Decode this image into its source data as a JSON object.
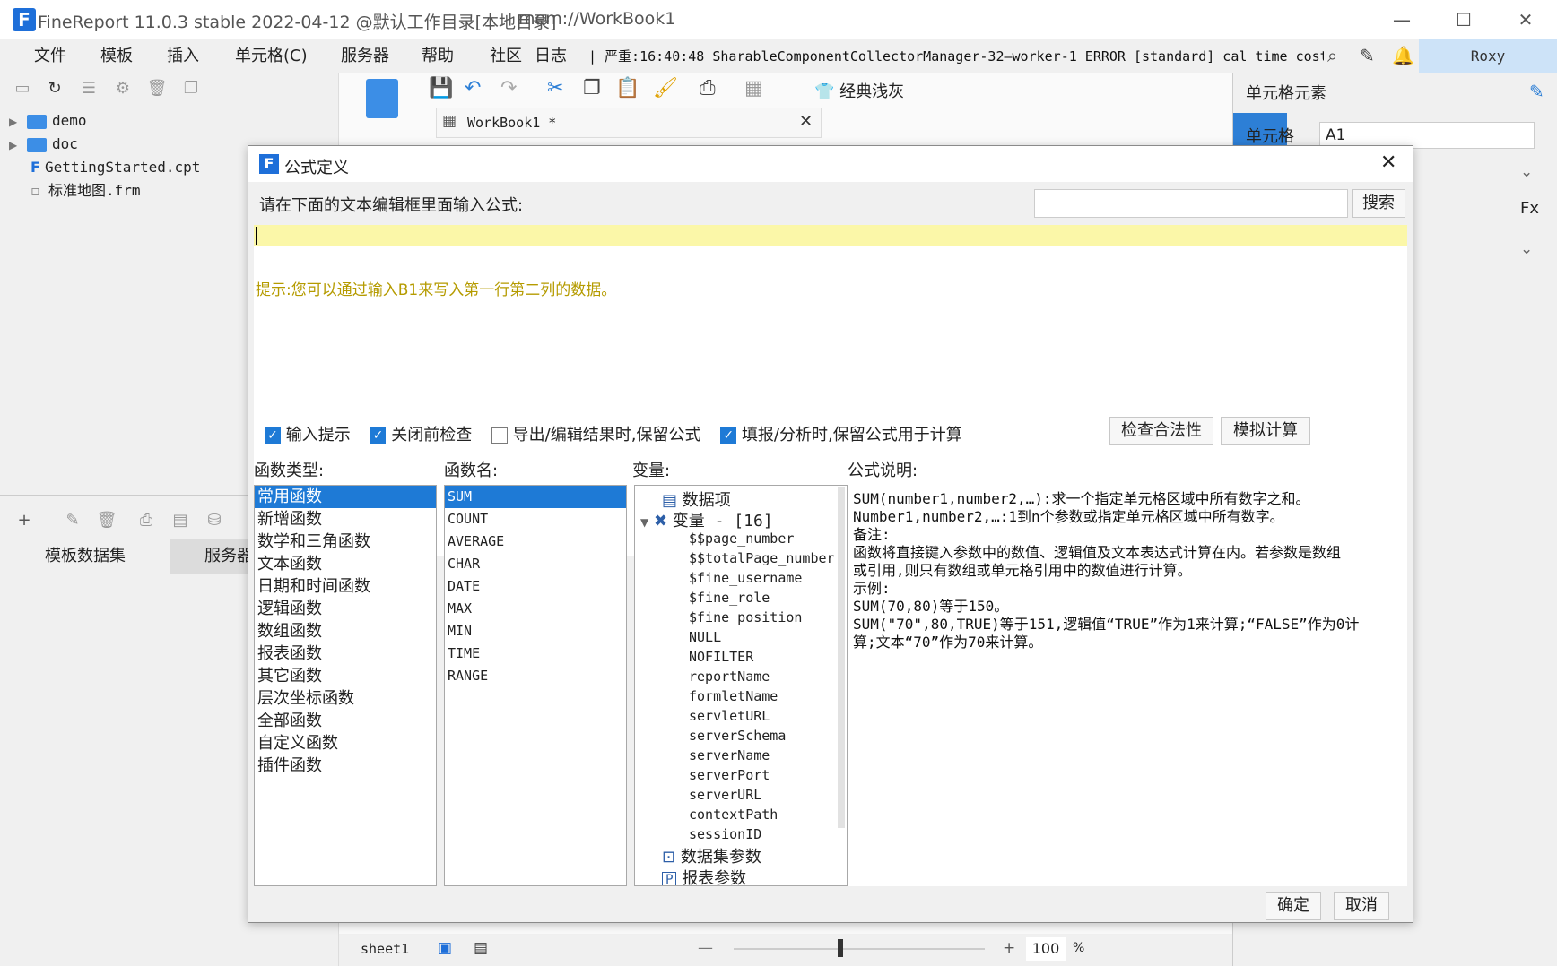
{
  "app": {
    "title": "FineReport 11.0.3 stable 2022-04-12 @默认工作目录[本地目录]",
    "path": "mem://WorkBook1",
    "user": "Roxy"
  },
  "window_controls": {
    "minimize": "—",
    "maximize": "☐",
    "close": "✕"
  },
  "menu": [
    "文件",
    "模板",
    "插入",
    "单元格(C)",
    "服务器",
    "帮助",
    "社区",
    "日志"
  ],
  "log_line": "| 严重:16:40:48 SharableComponentCollectorManager-32—worker-1 ERROR [standard] cal time cost...",
  "left": {
    "tree": [
      {
        "label": "demo",
        "type": "folder"
      },
      {
        "label": "doc",
        "type": "folder"
      },
      {
        "label": "GettingStarted.cpt",
        "type": "file"
      },
      {
        "label": "标准地图.frm",
        "type": "file"
      }
    ],
    "bottom_tabs": [
      "模板数据集",
      "服务器"
    ]
  },
  "center": {
    "tab_label": "WorkBook1 *",
    "theme_button": "经典浅灰",
    "sheet": "sheet1",
    "zoom": "100",
    "zoom_unit": "%"
  },
  "right": {
    "title": "单元格元素",
    "cell_label": "单元格",
    "cell_value": "A1"
  },
  "dialog": {
    "title": "公式定义",
    "instruction": "请在下面的文本编辑框里面输入公式:",
    "search_placeholder": "",
    "search_button": "搜索",
    "hint": "提示:您可以通过输入B1来写入第一行第二列的数据。",
    "options": [
      {
        "label": "输入提示",
        "checked": true
      },
      {
        "label": "关闭前检查",
        "checked": true
      },
      {
        "label": "导出/编辑结果时,保留公式",
        "checked": false
      },
      {
        "label": "填报/分析时,保留公式用于计算",
        "checked": true
      }
    ],
    "check_button": "检查合法性",
    "simulate_button": "模拟计算",
    "headers": {
      "types": "函数类型:",
      "names": "函数名:",
      "vars": "变量:",
      "desc": "公式说明:"
    },
    "function_types": [
      "常用函数",
      "新增函数",
      "数学和三角函数",
      "文本函数",
      "日期和时间函数",
      "逻辑函数",
      "数组函数",
      "报表函数",
      "其它函数",
      "层次坐标函数",
      "全部函数",
      "自定义函数",
      "插件函数"
    ],
    "function_names": [
      "SUM",
      "COUNT",
      "AVERAGE",
      "CHAR",
      "DATE",
      "MAX",
      "MIN",
      "TIME",
      "RANGE"
    ],
    "variables": {
      "data_item": "数据项",
      "var_group": "变量 - [16]",
      "vars": [
        "$$page_number",
        "$$totalPage_number",
        "$fine_username",
        "$fine_role",
        "$fine_position",
        "NULL",
        "NOFILTER",
        "reportName",
        "formletName",
        "servletURL",
        "serverSchema",
        "serverName",
        "serverPort",
        "serverURL",
        "contextPath",
        "sessionID"
      ],
      "dataset_params": "数据集参数",
      "report_params": "报表参数"
    },
    "description": [
      "SUM(number1,number2,…):求一个指定单元格区域中所有数字之和。",
      "Number1,number2,…:1到n个参数或指定单元格区域中所有数字。",
      "备注:",
      "函数将直接键入参数中的数值、逻辑值及文本表达式计算在内。若参数是数组",
      "或引用,则只有数组或单元格引用中的数值进行计算。",
      "示例:",
      "SUM(70,80)等于150。",
      "SUM(\"70\",80,TRUE)等于151,逻辑值“TRUE”作为1来计算;“FALSE”作为0计",
      "算;文本“70”作为70来计算。"
    ],
    "ok_button": "确定",
    "cancel_button": "取消"
  },
  "colors": {
    "accent": "#1e7ad6",
    "editor_bg": "#fbf7a8",
    "hint": "#b59b00"
  }
}
